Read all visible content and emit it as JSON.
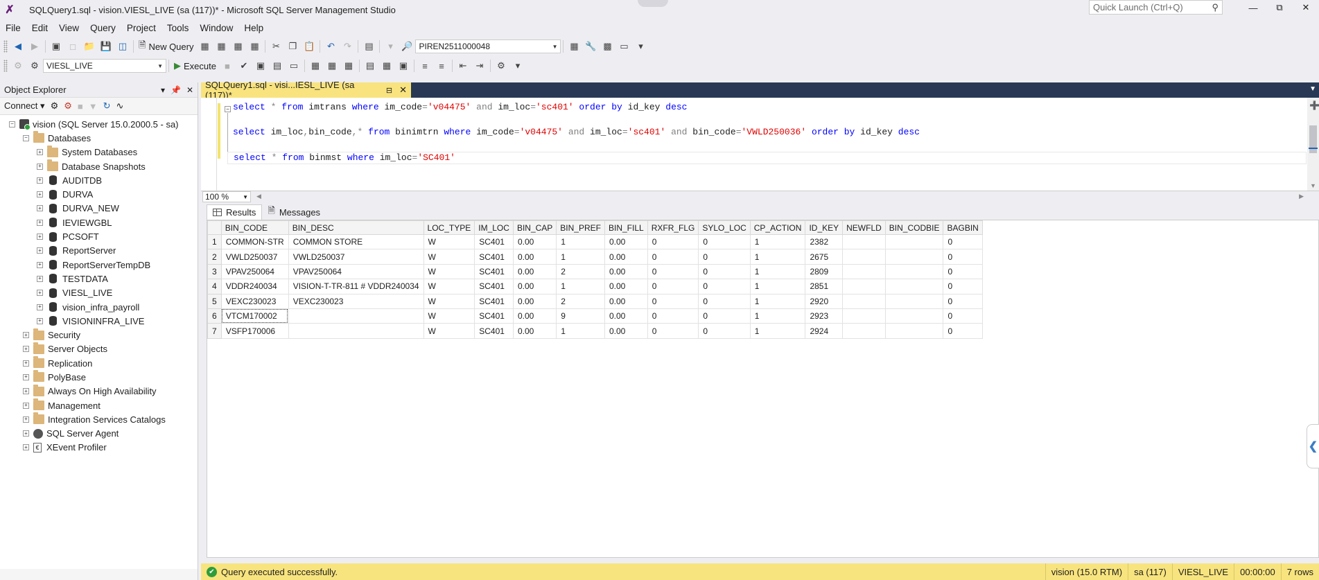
{
  "window": {
    "title": "SQLQuery1.sql - vision.VIESL_LIVE (sa (117))* - Microsoft SQL Server Management Studio",
    "quick_launch_placeholder": "Quick Launch (Ctrl+Q)"
  },
  "menu": [
    "File",
    "Edit",
    "View",
    "Query",
    "Project",
    "Tools",
    "Window",
    "Help"
  ],
  "toolbar": {
    "new_query_label": "New Query",
    "solution_combo_value": "PIREN2511000048",
    "database_combo_value": "VIESL_LIVE",
    "execute_label": "Execute"
  },
  "object_explorer": {
    "title": "Object Explorer",
    "connect_label": "Connect",
    "server_node": "vision (SQL Server 15.0.2000.5 - sa)",
    "databases_label": "Databases",
    "databases": [
      {
        "name": "System Databases",
        "kind": "folder"
      },
      {
        "name": "Database Snapshots",
        "kind": "folder"
      },
      {
        "name": "AUDITDB",
        "kind": "db"
      },
      {
        "name": "DURVA",
        "kind": "db"
      },
      {
        "name": "DURVA_NEW",
        "kind": "db"
      },
      {
        "name": "IEVIEWGBL",
        "kind": "db"
      },
      {
        "name": "PCSOFT",
        "kind": "db"
      },
      {
        "name": "ReportServer",
        "kind": "db"
      },
      {
        "name": "ReportServerTempDB",
        "kind": "db"
      },
      {
        "name": "TESTDATA",
        "kind": "db"
      },
      {
        "name": "VIESL_LIVE",
        "kind": "db"
      },
      {
        "name": "vision_infra_payroll",
        "kind": "db"
      },
      {
        "name": "VISIONINFRA_LIVE",
        "kind": "db"
      }
    ],
    "server_folders": [
      "Security",
      "Server Objects",
      "Replication",
      "PolyBase",
      "Always On High Availability",
      "Management",
      "Integration Services Catalogs"
    ],
    "agent_label": "SQL Server Agent",
    "xevent_label": "XEvent Profiler"
  },
  "document_tab": {
    "label": "SQLQuery1.sql - visi...IESL_LIVE (sa (117))*"
  },
  "editor": {
    "line1": [
      {
        "t": "select",
        "c": "kw"
      },
      {
        "t": " ",
        "c": "id"
      },
      {
        "t": "*",
        "c": "op"
      },
      {
        "t": " ",
        "c": "id"
      },
      {
        "t": "from",
        "c": "kw"
      },
      {
        "t": " imtrans ",
        "c": "id"
      },
      {
        "t": "where",
        "c": "kw"
      },
      {
        "t": " im_code",
        "c": "id"
      },
      {
        "t": "=",
        "c": "op"
      },
      {
        "t": "'v04475'",
        "c": "str"
      },
      {
        "t": " ",
        "c": "id"
      },
      {
        "t": "and",
        "c": "op"
      },
      {
        "t": " im_loc",
        "c": "id"
      },
      {
        "t": "=",
        "c": "op"
      },
      {
        "t": "'sc401'",
        "c": "str"
      },
      {
        "t": " ",
        "c": "id"
      },
      {
        "t": "order by",
        "c": "kw"
      },
      {
        "t": " id_key ",
        "c": "id"
      },
      {
        "t": "desc",
        "c": "kw"
      }
    ],
    "line2": [
      {
        "t": "select",
        "c": "kw"
      },
      {
        "t": " im_loc",
        "c": "id"
      },
      {
        "t": ",",
        "c": "op"
      },
      {
        "t": "bin_code",
        "c": "id"
      },
      {
        "t": ",",
        "c": "op"
      },
      {
        "t": "*",
        "c": "op"
      },
      {
        "t": " ",
        "c": "id"
      },
      {
        "t": "from",
        "c": "kw"
      },
      {
        "t": " binimtrn ",
        "c": "id"
      },
      {
        "t": "where",
        "c": "kw"
      },
      {
        "t": " im_code",
        "c": "id"
      },
      {
        "t": "=",
        "c": "op"
      },
      {
        "t": "'v04475'",
        "c": "str"
      },
      {
        "t": " ",
        "c": "id"
      },
      {
        "t": "and",
        "c": "op"
      },
      {
        "t": " im_loc",
        "c": "id"
      },
      {
        "t": "=",
        "c": "op"
      },
      {
        "t": "'sc401'",
        "c": "str"
      },
      {
        "t": " ",
        "c": "id"
      },
      {
        "t": "and",
        "c": "op"
      },
      {
        "t": " bin_code",
        "c": "id"
      },
      {
        "t": "=",
        "c": "op"
      },
      {
        "t": "'VWLD250036'",
        "c": "str"
      },
      {
        "t": " ",
        "c": "id"
      },
      {
        "t": "order by",
        "c": "kw"
      },
      {
        "t": " id_key ",
        "c": "id"
      },
      {
        "t": "desc",
        "c": "kw"
      }
    ],
    "line3": [
      {
        "t": "select",
        "c": "kw"
      },
      {
        "t": " ",
        "c": "id"
      },
      {
        "t": "*",
        "c": "op"
      },
      {
        "t": " ",
        "c": "id"
      },
      {
        "t": "from",
        "c": "kw"
      },
      {
        "t": " binmst ",
        "c": "id"
      },
      {
        "t": "where",
        "c": "kw"
      },
      {
        "t": " im_loc",
        "c": "id"
      },
      {
        "t": "=",
        "c": "op"
      },
      {
        "t": "'SC401'",
        "c": "str"
      }
    ]
  },
  "zoom": "100 %",
  "results_tabs": {
    "results": "Results",
    "messages": "Messages"
  },
  "results": {
    "columns": [
      "BIN_CODE",
      "BIN_DESC",
      "LOC_TYPE",
      "IM_LOC",
      "BIN_CAP",
      "BIN_PREF",
      "BIN_FILL",
      "RXFR_FLG",
      "SYLO_LOC",
      "CP_ACTION",
      "ID_KEY",
      "NEWFLD",
      "BIN_CODBIE",
      "BAGBIN"
    ],
    "rows": [
      [
        "1",
        "COMMON-STR",
        "COMMON STORE",
        "W",
        "SC401",
        "0.00",
        "1",
        "0.00",
        "0",
        "0",
        "1",
        "2382",
        "",
        "",
        "0"
      ],
      [
        "2",
        "VWLD250037",
        "VWLD250037",
        "W",
        "SC401",
        "0.00",
        "1",
        "0.00",
        "0",
        "0",
        "1",
        "2675",
        "",
        "",
        "0"
      ],
      [
        "3",
        "VPAV250064",
        "VPAV250064",
        "W",
        "SC401",
        "0.00",
        "2",
        "0.00",
        "0",
        "0",
        "1",
        "2809",
        "",
        "",
        "0"
      ],
      [
        "4",
        "VDDR240034",
        "VISION-T-TR-811 # VDDR240034",
        "W",
        "SC401",
        "0.00",
        "1",
        "0.00",
        "0",
        "0",
        "1",
        "2851",
        "",
        "",
        "0"
      ],
      [
        "5",
        "VEXC230023",
        "VEXC230023",
        "W",
        "SC401",
        "0.00",
        "2",
        "0.00",
        "0",
        "0",
        "1",
        "2920",
        "",
        "",
        "0"
      ],
      [
        "6",
        "VTCM170002",
        "",
        "W",
        "SC401",
        "0.00",
        "9",
        "0.00",
        "0",
        "0",
        "1",
        "2923",
        "",
        "",
        "0"
      ],
      [
        "7",
        "VSFP170006",
        "",
        "W",
        "SC401",
        "0.00",
        "1",
        "0.00",
        "0",
        "0",
        "1",
        "2924",
        "",
        "",
        "0"
      ]
    ]
  },
  "status": {
    "message": "Query executed successfully.",
    "server": "vision (15.0 RTM)",
    "user": "sa (117)",
    "database": "VIESL_LIVE",
    "elapsed": "00:00:00",
    "rows": "7 rows"
  },
  "colors": {
    "status_bar": "#f8e47e",
    "doc_tab_active": "#f8e37e",
    "doc_tab_strip": "#293955",
    "keyword": "#0000ff",
    "string": "#e00000",
    "operator": "#808080"
  }
}
